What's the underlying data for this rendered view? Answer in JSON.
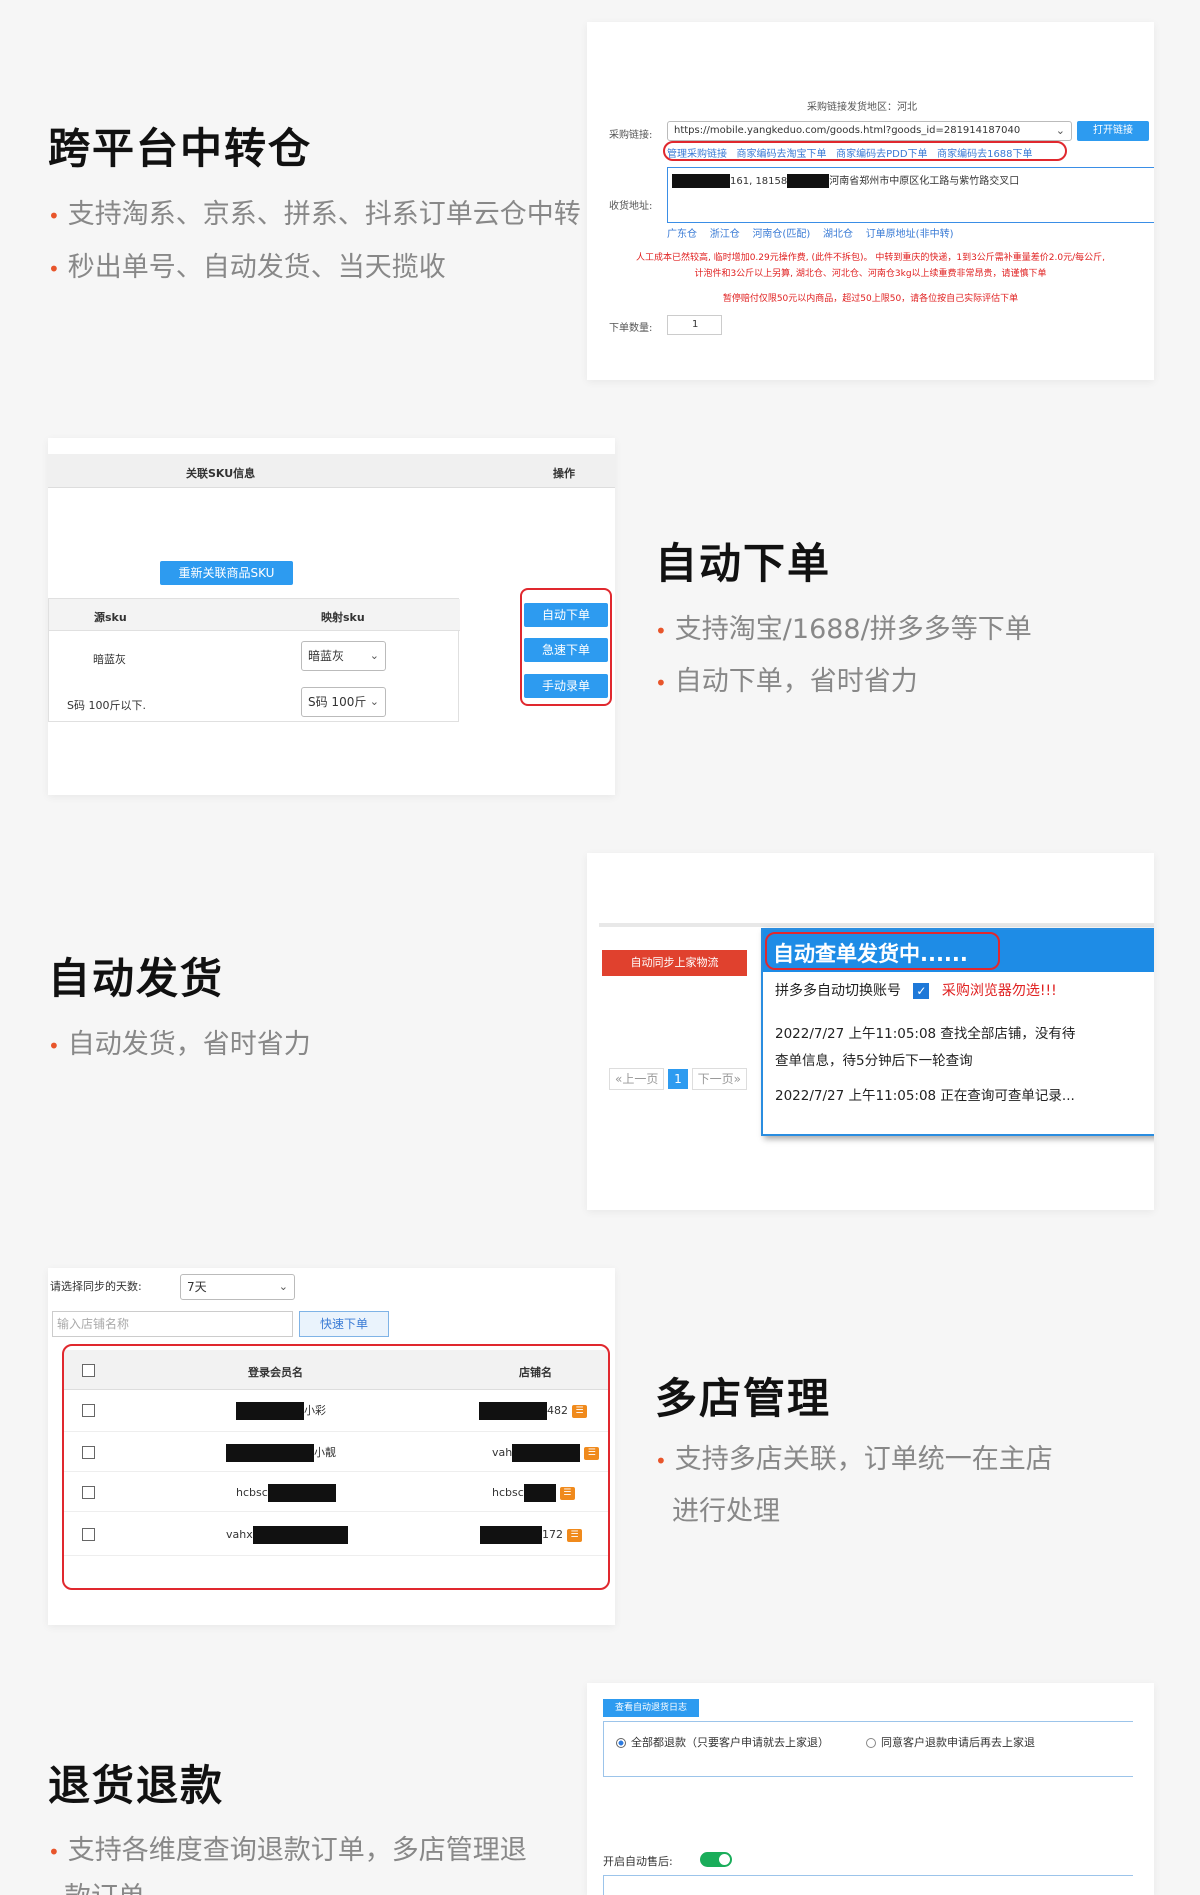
{
  "s1": {
    "title": "跨平台中转仓",
    "bullets": [
      "支持淘系、京系、拼系、抖系订单云仓中转",
      "秒出单号、自动发货、当天揽收"
    ],
    "header": "采购链接发货地区：河北",
    "link_label": "采购链接:",
    "link_value": "https://mobile.yangkeduo.com/goods.html?goods_id=281914187040",
    "open_btn": "打开链接",
    "link_actions": [
      "管理采购链接",
      "商家编码去淘宝下单",
      "商家编码去PDD下单",
      "商家编码去1688下单"
    ],
    "addr_label": "收货地址:",
    "addr_a": "161, 18158",
    "addr_b": "河南省郑州市中原区化工路与紫竹路交叉口",
    "warehouses": [
      "广东仓",
      "浙江仓",
      "河南仓(匹配)",
      "湖北仓",
      "订单原地址(非中转)"
    ],
    "warn1": "人工成本已然较高, 临时增加0.29元操作费, (此件不拆包)。 中转到重庆的快递，1到3公斤需补重量差价2.0元/每公斤,",
    "warn2": "计泡件和3公斤以上另算, 湖北仓、河北仓、河南仓3kg以上续重费非常昂贵，请谨慎下单",
    "warn3": "暂停赔付仅限50元以内商品，超过50上限50，请各位按自己实际评估下单",
    "qty_label": "下单数量:",
    "qty_value": "1"
  },
  "s2": {
    "title": "自动下单",
    "bullets": [
      "支持淘宝/1688/拼多多等下单",
      "自动下单，省时省力"
    ],
    "col_sku": "关联SKU信息",
    "col_op": "操作",
    "relink_btn": "重新关联商品SKU",
    "src_sku": "源sku",
    "map_sku": "映射sku",
    "rows": [
      {
        "src": "暗蓝灰",
        "map": "暗蓝灰"
      },
      {
        "src": "S码 100斤以下.",
        "map": "S码 100斤"
      }
    ],
    "btns": [
      "自动下单",
      "急速下单",
      "手动录单"
    ]
  },
  "s3": {
    "title": "自动发货",
    "bullets": [
      "自动发货，省时省力"
    ],
    "sync_btn": "自动同步上家物流",
    "pager": [
      "«上一页",
      "1",
      "下一页»"
    ],
    "popup_title": "自动查单发货中......",
    "switch_label": "拼多多自动切换账号",
    "warn": "采购浏览器勿选!!!",
    "log1": "2022/7/27 上午11:05:08 查找全部店铺，没有待",
    "log1b": "查单信息，待5分钟后下一轮查询",
    "log2": "2022/7/27 上午11:05:08 正在查询可查单记录..."
  },
  "s4": {
    "title": "多店管理",
    "bullets": [
      "支持多店关联，订单统一在主店",
      "进行处理"
    ],
    "days_label": "请选择同步的天数:",
    "days_value": "7天",
    "search_placeholder": "输入店铺名称",
    "quick_btn": "快速下单",
    "col_member": "登录会员名",
    "col_shop": "店铺名",
    "rows": [
      {
        "m_pre": "",
        "m_suf": "小彩",
        "s_pre": "",
        "s_suf": "482"
      },
      {
        "m_pre": "",
        "m_suf": "小靓",
        "s_pre": "vah",
        "s_suf": ""
      },
      {
        "m_pre": "hcbsc",
        "m_suf": "",
        "s_pre": "hcbsc",
        "s_suf": ""
      },
      {
        "m_pre": "vahx",
        "m_suf": "",
        "s_pre": "",
        "s_suf": "172"
      }
    ]
  },
  "s5": {
    "title": "退货退款",
    "bullets": [
      "支持各维度查询退款订单，多店管理退",
      "款订单"
    ],
    "log_btn": "查看自动退货日志",
    "opt1": "全部都退款（只要客户申请就去上家退）",
    "opt2": "同意客户退款申请后再去上家退",
    "auto_label": "开启自动售后:"
  }
}
